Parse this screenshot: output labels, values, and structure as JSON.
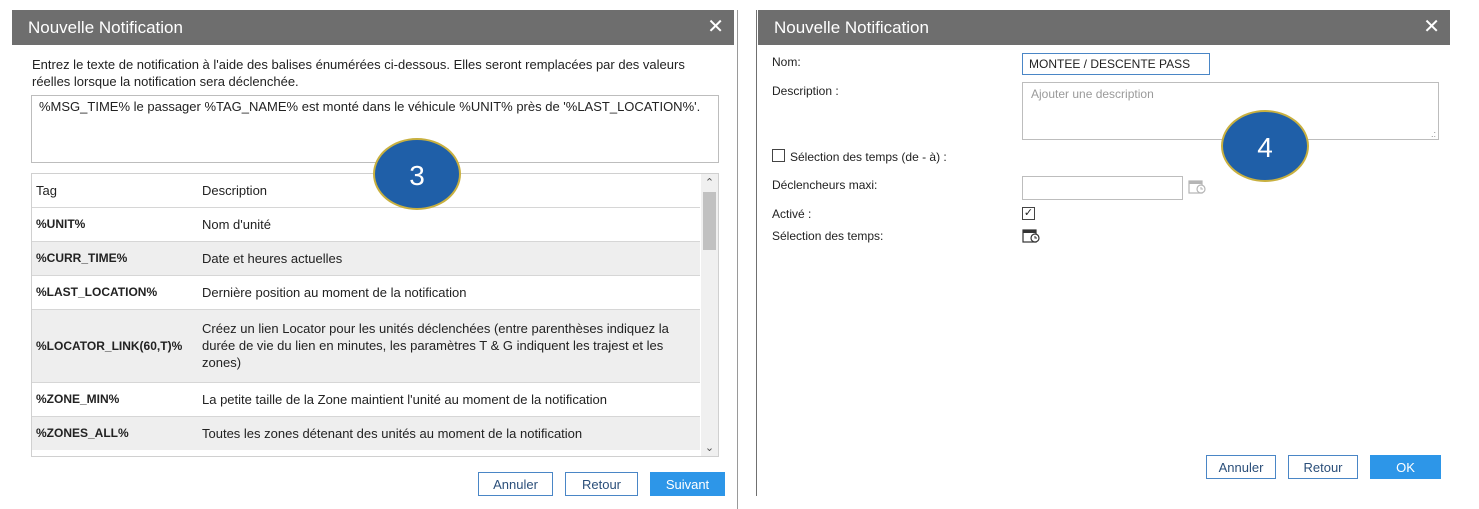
{
  "left_dialog": {
    "title": "Nouvelle Notification",
    "close_icon": "close-icon",
    "instructions": "Entrez le texte de notification à l'aide des balises énumérées ci-dessous. Elles seront remplacées par des valeurs réelles lorsque la notification sera déclenchée.",
    "message_text": "%MSG_TIME% le passager %TAG_NAME% est monté dans le véhicule %UNIT% près de '%LAST_LOCATION%'.",
    "table": {
      "headers": [
        "Tag",
        "Description"
      ],
      "rows": [
        {
          "tag": "%UNIT%",
          "description": "Nom d'unité"
        },
        {
          "tag": "%CURR_TIME%",
          "description": "Date et heures actuelles"
        },
        {
          "tag": "%LAST_LOCATION%",
          "description": "Dernière position au moment de la notification"
        },
        {
          "tag": "%LOCATOR_LINK(60,T)%",
          "description": "Créez un lien Locator pour les unités déclenchées (entre parenthèses indiquez la durée de vie du lien en minutes, les paramètres T & G indiquent les trajest et les zones)"
        },
        {
          "tag": "%ZONE_MIN%",
          "description": "La petite taille de la Zone maintient l'unité au moment de la notification"
        },
        {
          "tag": "%ZONES_ALL%",
          "description": "Toutes les zones détenant des unités au moment de la notification"
        }
      ]
    },
    "buttons": {
      "cancel": "Annuler",
      "back": "Retour",
      "next": "Suivant"
    },
    "badge": "3"
  },
  "right_dialog": {
    "title": "Nouvelle Notification",
    "close_icon": "close-icon",
    "name_label": "Nom:",
    "name_value": "MONTEE / DESCENTE PASS",
    "description_label": "Description :",
    "description_placeholder": "Ajouter une description",
    "time_selection_checkbox_label": "Sélection des temps (de - à) :",
    "max_triggers_label": "Déclencheurs maxi:",
    "max_triggers_value": "",
    "active_label": "Activé :",
    "active_checked": true,
    "time_selection_label": "Sélection des temps:",
    "buttons": {
      "cancel": "Annuler",
      "back": "Retour",
      "ok": "OK"
    },
    "badge": "4"
  }
}
